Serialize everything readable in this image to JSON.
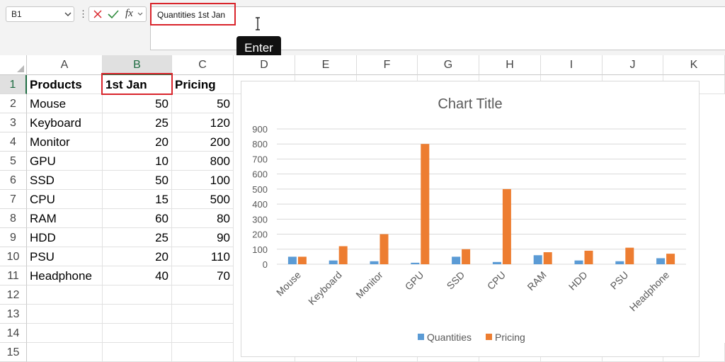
{
  "name_box": {
    "value": "B1"
  },
  "formula_bar": {
    "icons": [
      "cancel-icon",
      "enter-check-icon",
      "fx-icon"
    ],
    "fx_label": "fx",
    "value": "Quantities 1st Jan"
  },
  "tooltip": {
    "text": "Enter"
  },
  "grid": {
    "columns": [
      "A",
      "B",
      "C",
      "D",
      "E",
      "F",
      "G",
      "H",
      "I",
      "J",
      "K"
    ],
    "selected_column": "B",
    "rows": [
      "1",
      "2",
      "3",
      "4",
      "5",
      "6",
      "7",
      "8",
      "9",
      "10",
      "11",
      "12",
      "13",
      "14",
      "15"
    ],
    "selected_row": "1",
    "header_cells": [
      "Products",
      "1st Jan",
      "Pricing"
    ],
    "data": [
      [
        "Mouse",
        "50",
        "50"
      ],
      [
        "Keyboard",
        "25",
        "120"
      ],
      [
        "Monitor",
        "20",
        "200"
      ],
      [
        "GPU",
        "10",
        "800"
      ],
      [
        "SSD",
        "50",
        "100"
      ],
      [
        "CPU",
        "15",
        "500"
      ],
      [
        "RAM",
        "60",
        "80"
      ],
      [
        "HDD",
        "25",
        "90"
      ],
      [
        "PSU",
        "20",
        "110"
      ],
      [
        "Headphone",
        "40",
        "70"
      ]
    ]
  },
  "colors": {
    "quantities": "#5b9bd5",
    "pricing": "#ed7d31",
    "highlight": "#d9242b",
    "selected_header": "#1e6c41"
  },
  "chart_data": {
    "type": "bar",
    "title": "Chart Title",
    "categories": [
      "Mouse",
      "Keyboard",
      "Monitor",
      "GPU",
      "SSD",
      "CPU",
      "RAM",
      "HDD",
      "PSU",
      "Headphone"
    ],
    "series": [
      {
        "name": "Quantities",
        "values": [
          50,
          25,
          20,
          10,
          50,
          15,
          60,
          25,
          20,
          40
        ]
      },
      {
        "name": "Pricing",
        "values": [
          50,
          120,
          200,
          800,
          100,
          500,
          80,
          90,
          110,
          70
        ]
      }
    ],
    "yticks": [
      "0",
      "100",
      "200",
      "300",
      "400",
      "500",
      "600",
      "700",
      "800",
      "900"
    ],
    "ylim": [
      0,
      900
    ],
    "grid": true,
    "legend_position": "bottom"
  }
}
